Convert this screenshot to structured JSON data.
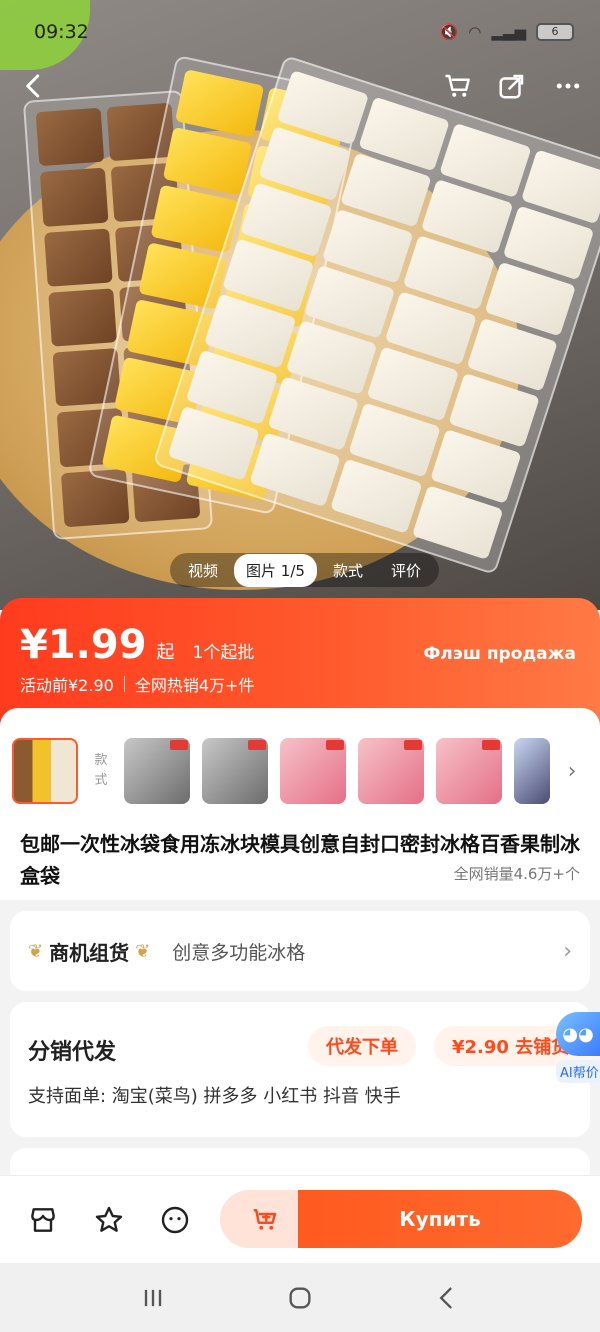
{
  "status_bar": {
    "time": "09:32",
    "battery": "6"
  },
  "media_tabs": [
    {
      "label": "视频"
    },
    {
      "label": "图片 1/5"
    },
    {
      "label": "款式"
    },
    {
      "label": "评价"
    }
  ],
  "price": {
    "value": "¥1.99",
    "suffix": "起",
    "moq": "1个起批",
    "before": "活动前¥2.90",
    "hot": "全网热销4万+件",
    "flash_label": "Флэш продажа"
  },
  "style_label": "款式",
  "product": {
    "title": "包邮一次性冰袋食用冻冰块模具创意自封口密封冰格百香果制冰盒袋",
    "sold": "全网销量4.6万+个"
  },
  "combo": {
    "title": "商机组货",
    "text": "创意多功能冰格"
  },
  "distribution": {
    "title": "分销代发",
    "order_button": "代发下单",
    "shop_button": "¥2.90 去铺货",
    "support": "支持面单: 淘宝(菜鸟) 拼多多 小红书 抖音 快手"
  },
  "ai_helper": {
    "label": "AI帮价"
  },
  "action_bar": {
    "buy_label": "Купить"
  },
  "colors": {
    "accent": "#ff4a1c",
    "banner_start": "#ff3b1e",
    "banner_end": "#ff7a45"
  }
}
